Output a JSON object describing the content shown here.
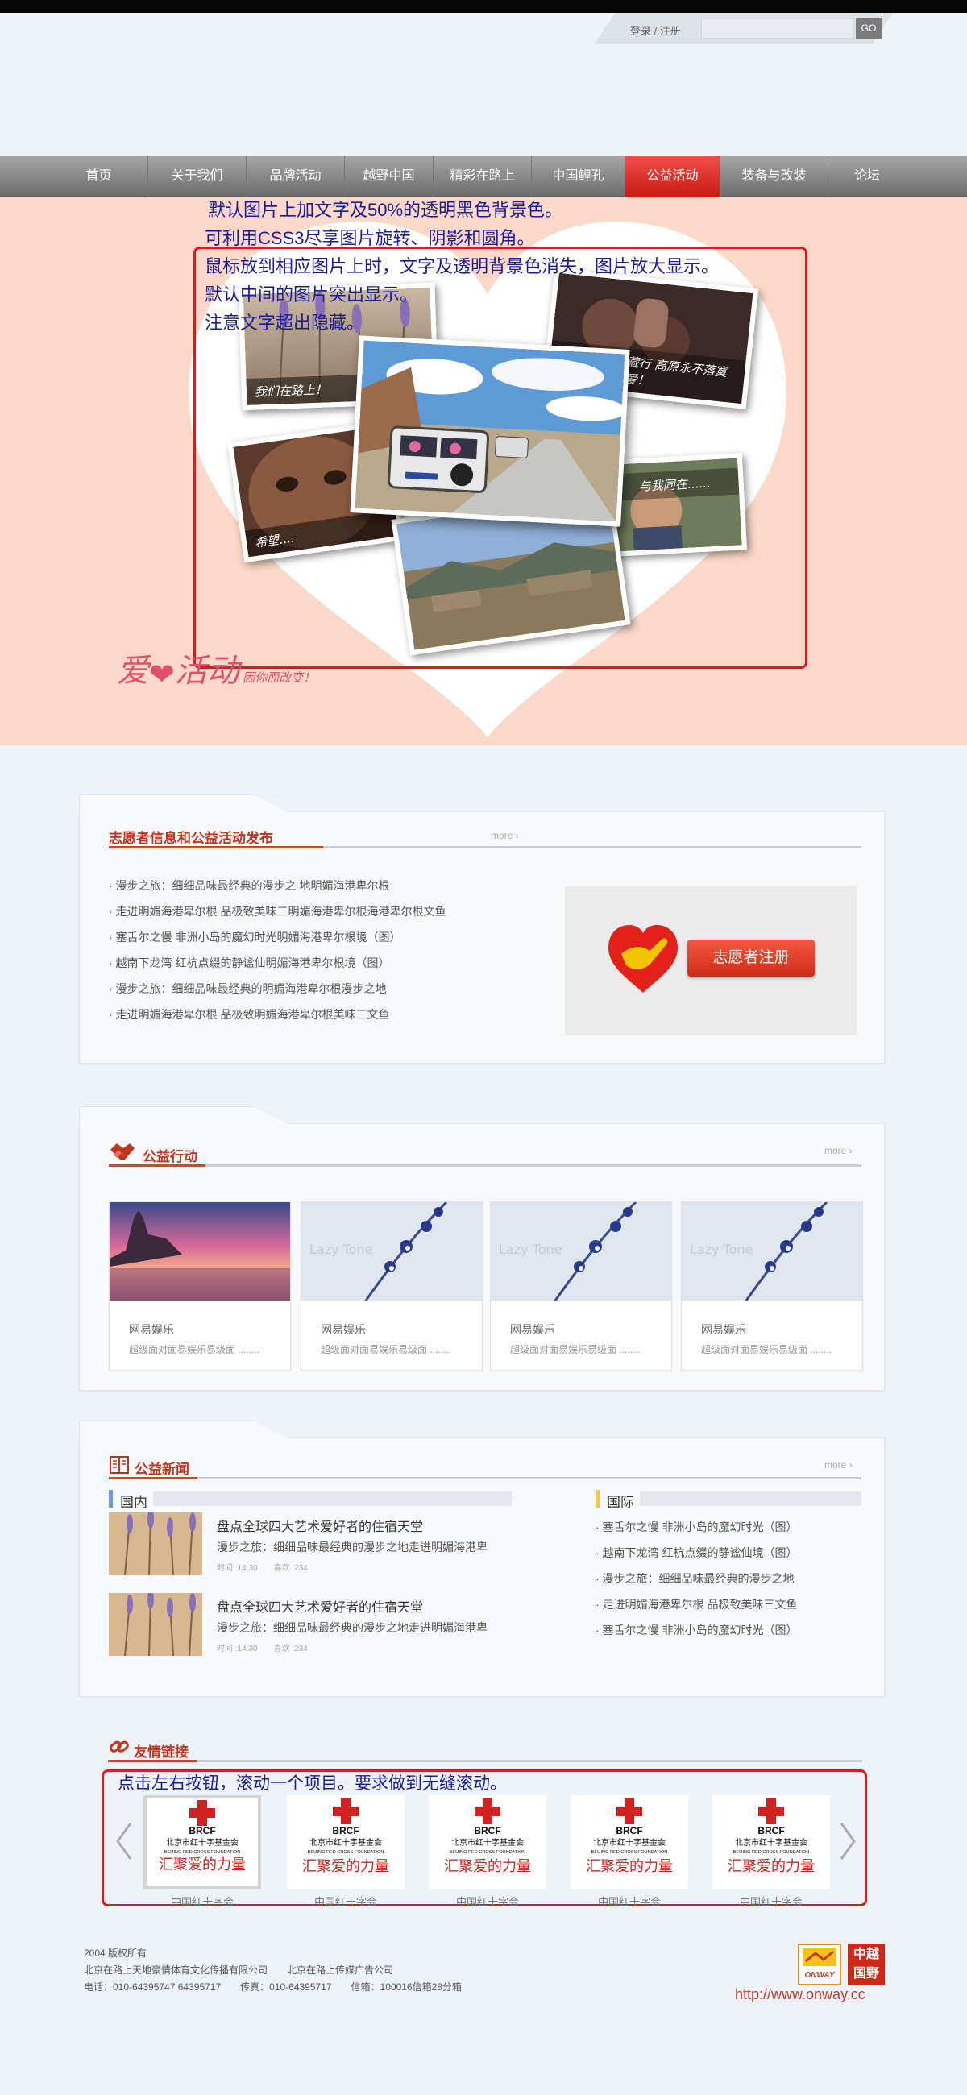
{
  "header": {
    "login_text": "登录 / 注册",
    "go_label": "GO"
  },
  "nav": {
    "items": [
      "首页",
      "关于我们",
      "品牌活动",
      "越野中国",
      "精彩在路上",
      "中国鲤孔",
      "公益活动",
      "装备与改装",
      "论坛"
    ],
    "active_index": 6
  },
  "banner": {
    "notes": [
      "默认图片上加文字及50%的透明黑色背景色。",
      "可利用CSS3尽享图片旋转、阴影和圆角。",
      "鼠标放到相应图片上时，文字及透明背景色消失，图片放大显示。",
      "默认中间的图片突出显示。",
      "注意文字超出隐藏。"
    ],
    "photo_captions": [
      "我们在路上！",
      "西藏行 高原永不落寞的爱！",
      "希望....",
      "与我同在......"
    ],
    "logo_title_left": "爱",
    "logo_title_right": "活动",
    "logo_subtitle": "因你而改变！"
  },
  "volunteer": {
    "title": "志愿者信息和公益活动发布",
    "more": "more",
    "items": [
      "· 漫步之旅：细细品味最经典的漫步之 地明媚海港卑尔根",
      "· 走进明媚海港卑尔根 品极致美味三明媚海港卑尔根海港卑尔根文鱼",
      "· 塞舌尔之慢 非洲小岛的魔幻时光明媚海港卑尔根境（图）",
      "· 越南下龙湾 红杭点缀的静谧仙明媚海港卑尔根境（图）",
      "· 漫步之旅：细细品味最经典的明媚海港卑尔根漫步之地",
      "· 走进明媚海港卑尔根 品极致明媚海港卑尔根美味三文鱼"
    ],
    "register_label": "志愿者注册"
  },
  "action": {
    "title": "公益行动",
    "more": "more",
    "cards": [
      {
        "title": "网易娱乐",
        "desc": "超级面对面易娱乐易级面 ........",
        "thumb": "sunset"
      },
      {
        "title": "网易娱乐",
        "desc": "超级面对面易娱乐易级面 ........",
        "thumb": "flowers"
      },
      {
        "title": "网易娱乐",
        "desc": "超级面对面易娱乐易级面 ........",
        "thumb": "flowers"
      },
      {
        "title": "网易娱乐",
        "desc": "超级面对面易娱乐易级面 ........",
        "thumb": "flowers"
      }
    ],
    "watermark": "Lazy Tone"
  },
  "news": {
    "title": "公益新闻",
    "more": "more",
    "domestic_label": "国内",
    "intl_label": "国际",
    "domestic": [
      {
        "title": "盘点全球四大艺术爱好者的住宿天堂",
        "desc": "漫步之旅：细细品味最经典的漫步之地走进明媚海港卑",
        "time": "时间 :14:30",
        "likes": "喜欢 :234"
      },
      {
        "title": "盘点全球四大艺术爱好者的住宿天堂",
        "desc": "漫步之旅：细细品味最经典的漫步之地走进明媚海港卑",
        "time": "时间 :14:30",
        "likes": "喜欢 :234"
      }
    ],
    "international": [
      "· 塞舌尔之慢 非洲小岛的魔幻时光（图）",
      "· 越南下龙湾 红杭点缀的静谧仙境（图）",
      "· 漫步之旅：细细品味最经典的漫步之地",
      "· 走进明媚海港卑尔根 品极致美味三文鱼",
      "· 塞舌尔之慢 非洲小岛的魔幻时光（图）"
    ]
  },
  "links": {
    "title": "友情链接",
    "note": "点击左右按钮，滚动一个项目。要求做到无缝滚动。",
    "tiles": [
      {
        "caption": "中国红十字会",
        "org_abbr": "BRCF",
        "org_cn": "北京市红十字基金会",
        "org_en": "BEIJING RED CROSS FOUNDATION",
        "slogan": "汇聚爱的力量"
      },
      {
        "caption": "中国红十字会",
        "org_abbr": "BRCF",
        "org_cn": "北京市红十字基金会",
        "org_en": "BEIJING RED CROSS FOUNDATION",
        "slogan": "汇聚爱的力量"
      },
      {
        "caption": "中国红十字会",
        "org_abbr": "BRCF",
        "org_cn": "北京市红十字基金会",
        "org_en": "BEIJING RED CROSS FOUNDATION",
        "slogan": "汇聚爱的力量"
      },
      {
        "caption": "中国红十字会",
        "org_abbr": "BRCF",
        "org_cn": "北京市红十字基金会",
        "org_en": "BEIJING RED CROSS FOUNDATION",
        "slogan": "汇聚爱的力量"
      },
      {
        "caption": "中国红十字会",
        "org_abbr": "BRCF",
        "org_cn": "北京市红十字基金会",
        "org_en": "BEIJING RED CROSS FOUNDATION",
        "slogan": "汇聚爱的力量"
      }
    ]
  },
  "footer": {
    "lines": [
      "2004 版权所有",
      "北京在路上天地豪情体育文化传播有限公司　　北京在路上传媒广告公司",
      "电话：010-64395747 64395717　　传真：010-64395717　　信箱：100016信箱28分箱"
    ],
    "url": "http://www.onway.cc",
    "onway_logo_text": "ONWAY",
    "cyg_logo_text": [
      "中越",
      "国野"
    ]
  },
  "colors": {
    "accent_red": "#d8412a",
    "nav_active": "#d8271c",
    "banner_bg": "#fbd8c7",
    "note_text": "#1c1c96",
    "annotation_border": "#d81b1b"
  }
}
